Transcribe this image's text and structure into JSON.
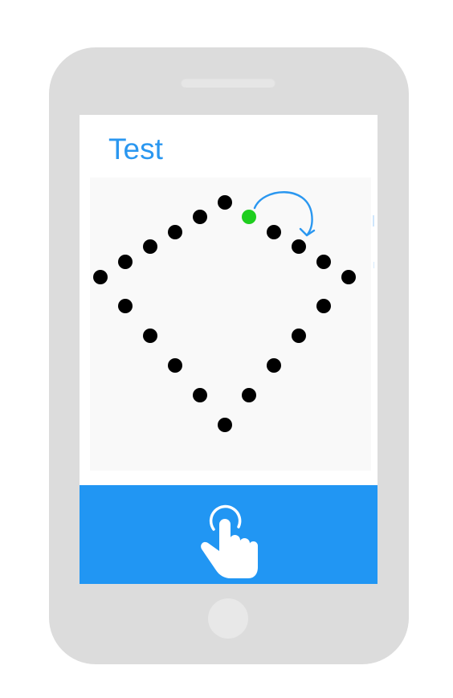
{
  "screen": {
    "title": "Test"
  },
  "colors": {
    "title": "#2a97f0",
    "dot": "#000000",
    "active_dot": "#1fce1f",
    "arrow": "#2a97f0",
    "action_bar": "#2196f3"
  },
  "icons": {
    "rotate_hint": "clockwise-arrow-icon",
    "action": "tap-hand-icon"
  }
}
